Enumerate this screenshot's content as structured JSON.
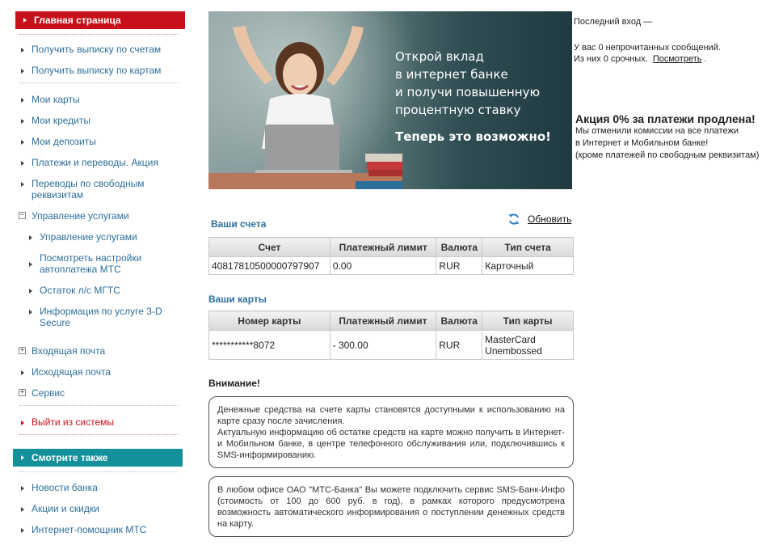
{
  "sidebar": {
    "main_label": "Главная страница",
    "items": [
      {
        "label": "Получить выписку по счетам"
      },
      {
        "label": "Получить выписку по картам"
      },
      {
        "label": "Мои карты"
      },
      {
        "label": "Мои кредиты"
      },
      {
        "label": "Мои депозиты"
      },
      {
        "label": "Платежи и переводы. Акция"
      },
      {
        "label": "Переводы по свободным реквизитам"
      },
      {
        "label": "Управление услугами"
      },
      {
        "label": "Входящая почта"
      },
      {
        "label": "Исходящая почта"
      },
      {
        "label": "Сервис"
      },
      {
        "label": "Выйти из системы"
      }
    ],
    "sub_items": [
      {
        "label": "Управление услугами"
      },
      {
        "label": "Посмотреть настройки автоплатежа МТС"
      },
      {
        "label": "Остаток л/с МГТС"
      },
      {
        "label": "Информация по услуге 3-D Secure"
      }
    ],
    "see_also_label": "Смотрите также",
    "see_also": [
      {
        "label": "Новости банка"
      },
      {
        "label": "Акции и скидки"
      },
      {
        "label": "Интернет-помощник МТС"
      }
    ]
  },
  "banner": {
    "line1": "Открой вклад",
    "line2": "в интернет банке",
    "line3": "и получи повышенную",
    "line4": "процентную ставку",
    "strong": "Теперь это возможно!"
  },
  "info": {
    "last_login": "Последний вход —",
    "messages": "У вас 0 непрочитанных сообщений.",
    "urgent": "Из них 0 срочных.",
    "view_link": "Посмотреть",
    "view_suffix": "."
  },
  "promo": {
    "title": "Акция 0% за платежи продлена!",
    "line1": "Мы отменили комиссии на все платежи",
    "line2": "в Интернет и Мобильном банке!",
    "line3": "(кроме платежей по свободным реквизитам)"
  },
  "accounts": {
    "title": "Ваши счета",
    "refresh_label": "Обновить",
    "headers": [
      "Счет",
      "Платежный лимит",
      "Валюта",
      "Тип счета"
    ],
    "rows": [
      [
        "40817810500000797907",
        "0.00",
        "RUR",
        "Карточный"
      ]
    ]
  },
  "cards": {
    "title": "Ваши карты",
    "headers": [
      "Номер карты",
      "Платежный лимит",
      "Валюта",
      "Тип карты"
    ],
    "rows": [
      [
        "***********8072",
        "- 300.00",
        "RUR",
        "MasterCard Unembossed"
      ]
    ]
  },
  "attention": {
    "title": "Внимание!",
    "notice1_p1": "Денежные средства на счете карты становятся доступными к использованию на карте сразу после зачисления.",
    "notice1_p2": "Актуальную информацию об остатке средств на карте можно получить в Интернет- и Мобильном банке, в центре телефонного обслуживания или, подключившись к SMS-информированию.",
    "notice2": "В любом офисе ОАО \"МТС-Банка\" Вы можете подключить сервис SMS-Банк-Инфо (стоимость от 100 до 600 руб. в год), в рамках которого предусмотрена возможность автоматического информирования о поступлении денежных средств на карту."
  },
  "colors": {
    "brand_red": "#c8101a",
    "teal": "#14909b",
    "link_blue": "#2d6f9b"
  }
}
